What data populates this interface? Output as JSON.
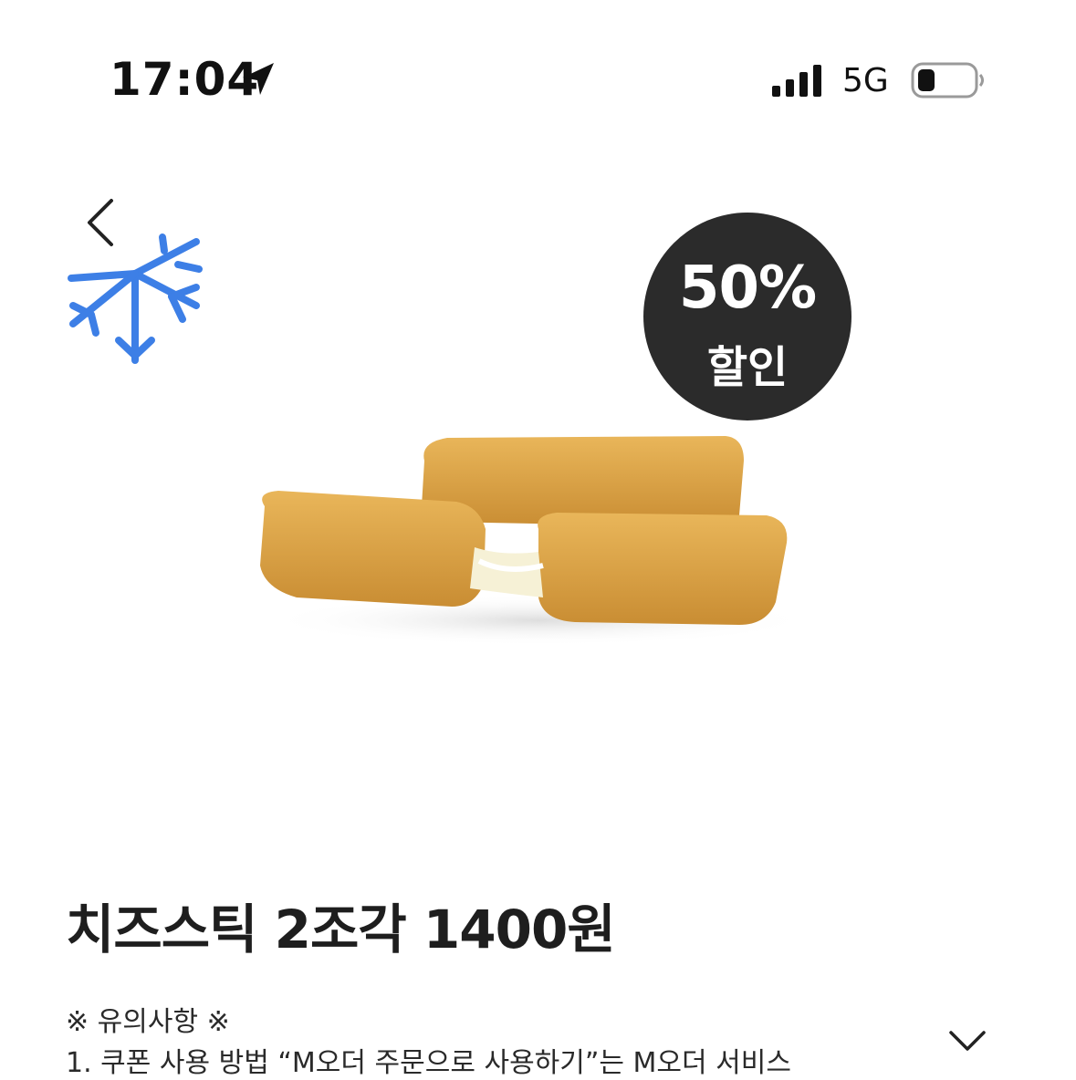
{
  "status_bar": {
    "time": "17:04",
    "network": "5G",
    "icons": [
      "location-arrow-icon",
      "signal-bars-icon",
      "battery-icon"
    ]
  },
  "header": {
    "back_icon": "chevron-left-icon",
    "category_icon": "snowflake-icon"
  },
  "badge": {
    "percent": "50%",
    "label": "할인"
  },
  "product": {
    "title": "치즈스틱 2조각 1400원",
    "image": "cheese-sticks-photo"
  },
  "notice": {
    "heading": "※ 유의사항 ※",
    "line1": "1. 쿠폰 사용 방법 “M오더 주문으로 사용하기”는 M오더 서비스",
    "expand_icon": "chevron-down-icon"
  },
  "colors": {
    "background": "#ffffff",
    "badge": "#2b2b2b",
    "snowflake": "#3d7fe6",
    "text": "#1e1e1e"
  }
}
